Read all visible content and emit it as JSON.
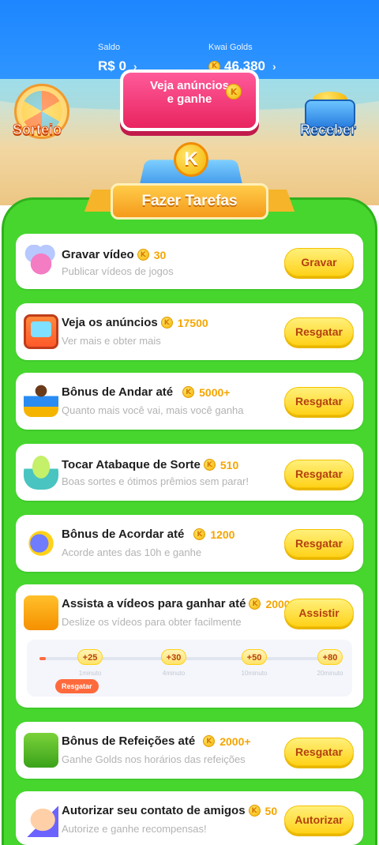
{
  "header": {
    "saldo_label": "Saldo",
    "saldo_value": "R$ 0",
    "golds_label": "Kwai Golds",
    "golds_value": "46.380",
    "chevron": "›"
  },
  "scene": {
    "sorteio_label": "Sorteio",
    "receber_label": "Receber",
    "ads_button_line1": "Veja anúncios",
    "ads_button_line2": "e ganhe",
    "coin_letter": "K",
    "ribbon_label": "Fazer Tarefas"
  },
  "tasks": [
    {
      "title": "Gravar vídeo",
      "reward": "30",
      "desc": "Publicar vídeos de jogos",
      "button": "Gravar",
      "icon": "camera-icon"
    },
    {
      "title": "Veja os anúncios",
      "reward": "17500",
      "desc": "Ver mais e obter mais",
      "button": "Resgatar",
      "icon": "tv-icon"
    },
    {
      "title": "Bônus de Andar até",
      "reward": "5000+",
      "desc": "Quanto mais você vai, mais você ganha",
      "button": "Resgatar",
      "icon": "runner-icon"
    },
    {
      "title": "Tocar Atabaque de Sorte",
      "reward": "510",
      "desc": "Boas sortes e ótimos prêmios sem parar!",
      "button": "Resgatar",
      "icon": "drum-icon"
    },
    {
      "title": "Bônus de Acordar até",
      "reward": "1200",
      "desc": "Acorde antes das 10h e ganhe",
      "button": "Resgatar",
      "icon": "alarm-clock-icon"
    },
    {
      "title": "Assista a vídeos para ganhar até",
      "reward": "2000",
      "desc": "Deslize os vídeos para obter facilmente",
      "button": "Assistir",
      "icon": "video-camera-icon"
    },
    {
      "title": "Bônus de Refeições até",
      "reward": "2000+",
      "desc": "Ganhe Golds nos horários das refeições",
      "button": "Resgatar",
      "icon": "meal-icon"
    },
    {
      "title": "Autorizar seu contato de amigos",
      "reward": "50",
      "desc": "Autorize e ganhe recompensas!",
      "button": "Autorizar",
      "icon": "hand-icon"
    }
  ],
  "watch_progress": {
    "progress_fraction": 0.02,
    "steps": [
      {
        "chip": "+25",
        "sub": "1minuto"
      },
      {
        "chip": "+30",
        "sub": "4minuto"
      },
      {
        "chip": "+50",
        "sub": "10minuto"
      },
      {
        "chip": "+80",
        "sub": "20minuto"
      }
    ],
    "claim_label": "Resgatar"
  }
}
